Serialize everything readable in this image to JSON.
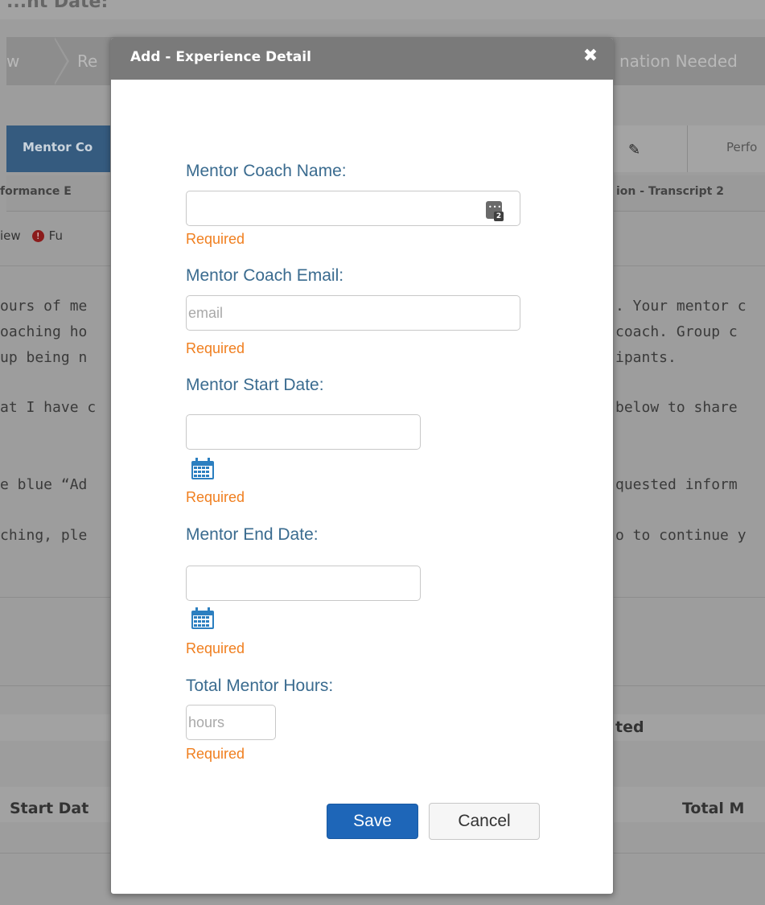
{
  "background": {
    "top_title": "...nt Date:",
    "wizard_steps": [
      "w",
      "Re",
      "nation Needed"
    ],
    "tab_active": "Mentor Co",
    "tab_right": "Perfo",
    "sub_left": "formance E",
    "sub_right": "ion - Transcript 2",
    "filter_view": "iew",
    "filter_alert_icon": "exclamation-icon",
    "filter_alert_text": "Fu",
    "left_text_lines": [
      "ours of me",
      "oaching ho",
      "up being n",
      "at I have c",
      "e blue “Ad",
      "ching, ple"
    ],
    "right_text_lines": [
      ". Your mentor c",
      "coach. Group c",
      "ipants.",
      "below to share",
      "quested inform",
      "o to continue y"
    ],
    "table_left_header": "Start Dat",
    "table_right_header": "Total M",
    "table_mid_header": "ted"
  },
  "modal": {
    "title": "Add - Experience Detail",
    "close_icon": "close-icon",
    "fields": {
      "coach_name_label": "Mentor Coach Name:",
      "coach_name_value": "",
      "coach_email_label": "Mentor Coach Email:",
      "coach_email_placeholder": "email",
      "start_date_label": "Mentor Start Date:",
      "start_date_value": "",
      "end_date_label": "Mentor End Date:",
      "end_date_value": "",
      "total_hours_label": "Total Mentor Hours:",
      "total_hours_placeholder": "hours"
    },
    "required_text": "Required",
    "contact_icon": "contact-picker-icon",
    "calendar_icon": "calendar-icon",
    "save_label": "Save",
    "cancel_label": "Cancel"
  },
  "colors": {
    "label": "#3a6b8f",
    "required": "#f07f1f",
    "save_button": "#1e66b8",
    "header": "#7a7a7a"
  }
}
